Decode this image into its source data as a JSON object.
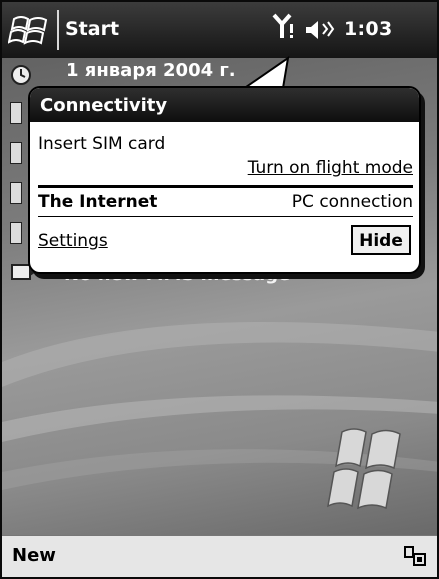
{
  "status_bar": {
    "start_label": "Start",
    "time": "1:03",
    "icons": [
      "windows-flag-icon",
      "signal-icon",
      "speaker-icon"
    ]
  },
  "today": {
    "date": "1 января 2004 г.",
    "message": "No new MMS message"
  },
  "connectivity": {
    "title": "Connectivity",
    "sim_text": "Insert SIM card",
    "flight_link": "Turn on flight mode",
    "internet_label": "The Internet",
    "internet_status": "PC connection",
    "settings_link": "Settings",
    "hide_button": "Hide"
  },
  "menu_bar": {
    "left_label": "New",
    "right_icon": "input-panel-icon"
  }
}
